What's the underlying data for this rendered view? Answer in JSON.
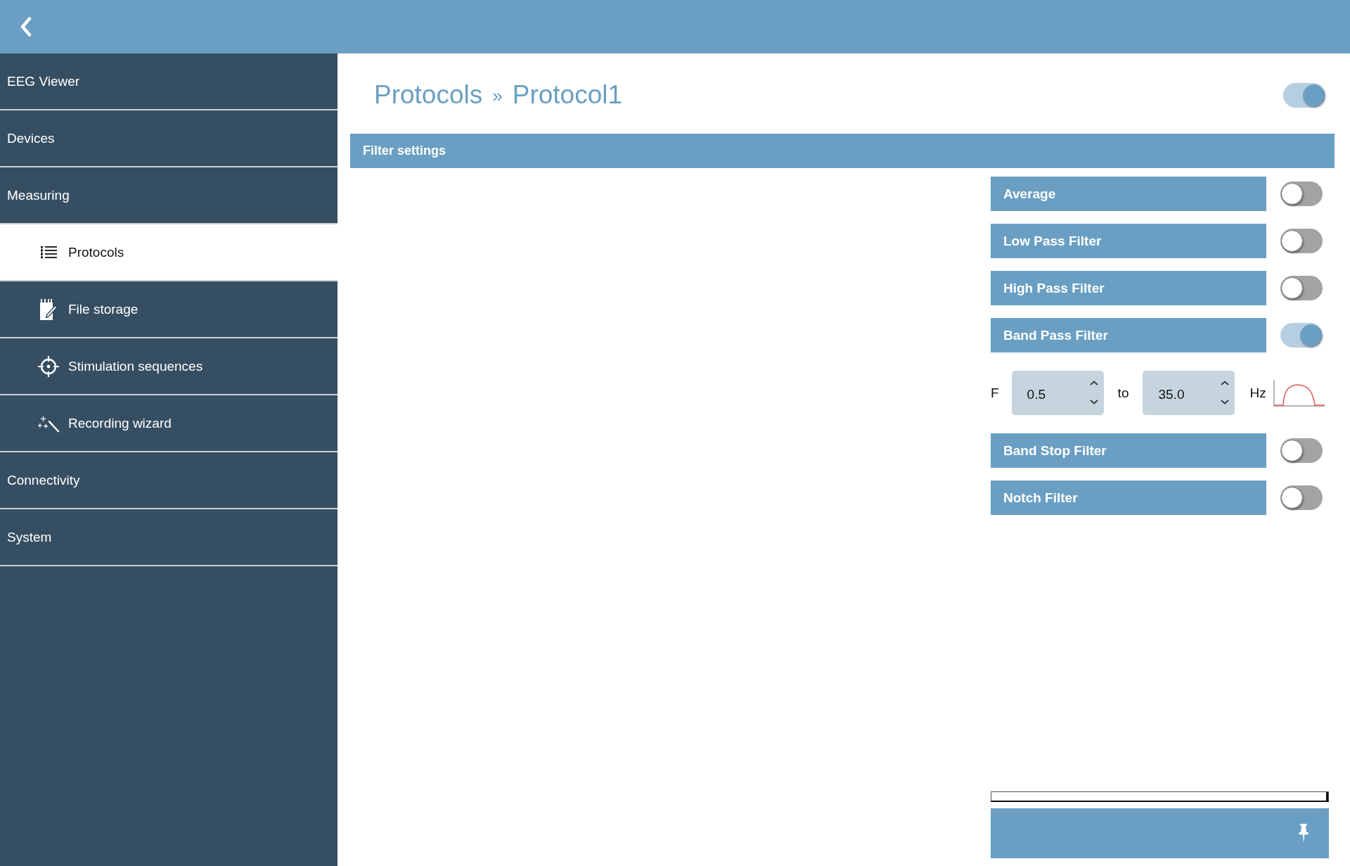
{
  "sidebar": {
    "items": [
      {
        "label": "EEG Viewer",
        "selected": false
      },
      {
        "label": "Devices",
        "selected": false
      },
      {
        "label": "Measuring",
        "selected": false,
        "children": [
          {
            "label": "Protocols",
            "selected": true
          },
          {
            "label": "File storage",
            "selected": false
          },
          {
            "label": "Stimulation sequences",
            "selected": false
          },
          {
            "label": "Recording wizard",
            "selected": false
          }
        ]
      },
      {
        "label": "Connectivity",
        "selected": false
      },
      {
        "label": "System",
        "selected": false
      }
    ]
  },
  "breadcrumb": {
    "items": [
      "Protocols",
      "Protocol1"
    ],
    "separator": "»"
  },
  "protocol_toggle": {
    "on": true
  },
  "section": {
    "title": "Filter settings"
  },
  "filters": [
    {
      "label": "Average",
      "on": false
    },
    {
      "label": "Low Pass Filter",
      "on": false
    },
    {
      "label": "High Pass Filter",
      "on": false
    },
    {
      "label": "Band Pass Filter",
      "on": true,
      "range": {
        "prefix": "F",
        "from": "0.5",
        "joiner": "to",
        "to": "35.0",
        "unit": "Hz"
      }
    },
    {
      "label": "Band Stop Filter",
      "on": false
    },
    {
      "label": "Notch Filter",
      "on": false
    }
  ]
}
